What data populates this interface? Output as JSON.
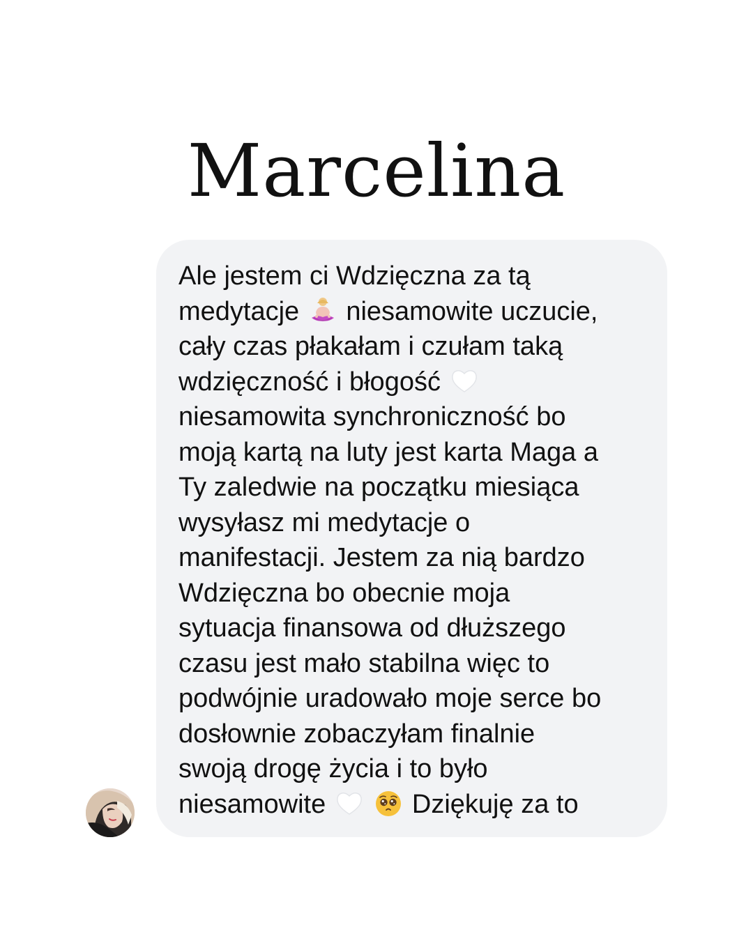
{
  "header": {
    "title": "Marcelina"
  },
  "message": {
    "sender_avatar_icon": "avatar-icon",
    "colors": {
      "bubble_bg": "#f2f3f5",
      "text": "#111111"
    },
    "lines": [
      "Ale jestem ci Wdzięczna za tą",
      "medytacje ",
      " niesamowite uczucie,",
      "cały czas płakałam i czułam taką",
      "wdzięczność i błogość",
      "niesamowita synchroniczność bo",
      "moją kartą na luty jest karta Maga a",
      "Ty zaledwie na początku miesiąca",
      "wysyłasz mi medytacje o",
      "manifestacji. Jestem za nią bardzo",
      "Wdzięczna bo obecnie moja",
      "sytuacja finansowa od dłuższego",
      "czasu jest mało stabilna więc to",
      "podwójnie uradowało moje serce bo",
      "dosłownie zobaczyłam finalnie",
      "swoją drogę życia i to było",
      "niesamowite",
      "Dziękuję za to"
    ],
    "emoji": {
      "yoga": "person-in-lotus-position-emoji",
      "heart": "white-heart-emoji",
      "pleading": "pleading-face-emoji"
    }
  }
}
